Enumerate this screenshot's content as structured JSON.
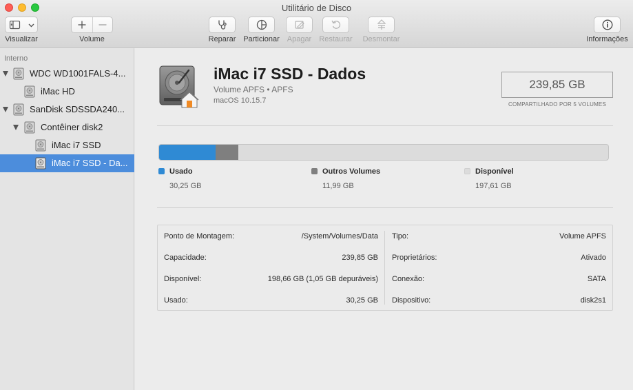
{
  "window": {
    "title": "Utilitário de Disco"
  },
  "toolbar": {
    "visualizar": "Visualizar",
    "volume": "Volume",
    "reparar": "Reparar",
    "particionar": "Particionar",
    "apagar": "Apagar",
    "restaurar": "Restaurar",
    "desmontar": "Desmontar",
    "informacoes": "Informações",
    "icons": [
      "sidebar-icon",
      "chevron-down-icon",
      "plus-icon",
      "minus-icon",
      "stethoscope-icon",
      "pie-icon",
      "eraser-icon",
      "restore-icon",
      "unmount-icon",
      "info-icon"
    ]
  },
  "sidebar": {
    "section": "Interno",
    "items": [
      {
        "label": "WDC WD1001FALS-4...",
        "level": 0,
        "disclosure": true
      },
      {
        "label": "iMac HD",
        "level": 1,
        "disclosure": false
      },
      {
        "label": "SanDisk SDSSDA240...",
        "level": 0,
        "disclosure": true
      },
      {
        "label": "Contêiner disk2",
        "level": 1,
        "disclosure": true
      },
      {
        "label": "iMac i7 SSD",
        "level": 2,
        "disclosure": false
      },
      {
        "label": "iMac i7 SSD - Da...",
        "level": 2,
        "disclosure": false,
        "selected": true
      }
    ]
  },
  "volume": {
    "title": "iMac i7 SSD - Dados",
    "subtitle": "Volume APFS • APFS",
    "os": "macOS 10.15.7",
    "size": "239,85 GB",
    "size_caption": "COMPARTILHADO POR 5 VOLUMES"
  },
  "usage": {
    "total_gb": 239.85,
    "segments": [
      {
        "name": "Usado",
        "value": "30,25 GB",
        "gb": 30.25,
        "color": "#2f8ad4"
      },
      {
        "name": "Outros Volumes",
        "value": "11,99 GB",
        "gb": 11.99,
        "color": "#7f7f7f"
      },
      {
        "name": "Disponível",
        "value": "197,61 GB",
        "gb": 197.61,
        "color": "#dcdcdc"
      }
    ]
  },
  "info": {
    "left": [
      {
        "key": "Ponto de Montagem:",
        "value": "/System/Volumes/Data"
      },
      {
        "key": "Capacidade:",
        "value": "239,85 GB"
      },
      {
        "key": "Disponível:",
        "value": "198,66 GB (1,05 GB depuráveis)"
      },
      {
        "key": "Usado:",
        "value": "30,25 GB"
      }
    ],
    "right": [
      {
        "key": "Tipo:",
        "value": "Volume APFS"
      },
      {
        "key": "Proprietários:",
        "value": "Ativado"
      },
      {
        "key": "Conexão:",
        "value": "SATA"
      },
      {
        "key": "Dispositivo:",
        "value": "disk2s1"
      }
    ]
  }
}
